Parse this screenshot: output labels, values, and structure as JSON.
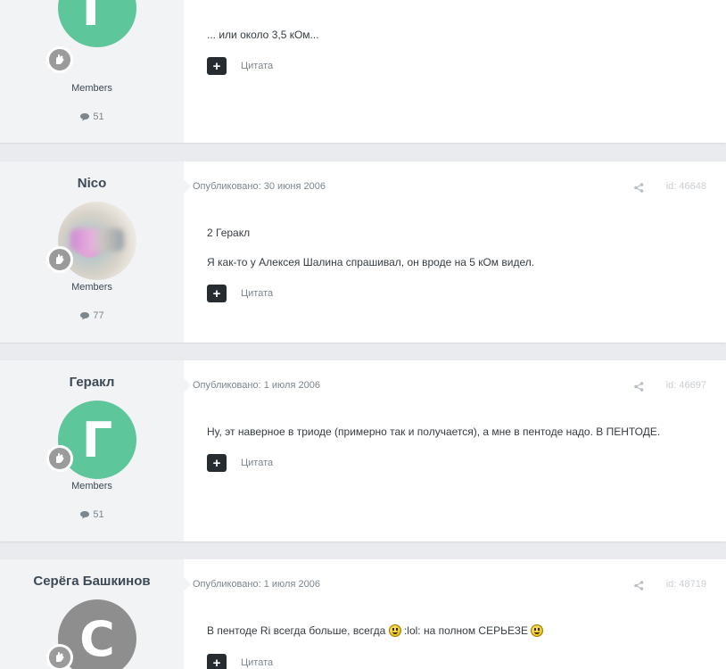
{
  "posts": [
    {
      "author": "",
      "avatar_letter": "Г",
      "avatar_color": "#5ec69b",
      "group": "Members",
      "post_count": "51",
      "date": "",
      "id": "",
      "lines": [
        "... или около 3,5 кОм..."
      ],
      "quote_label": "Цитата"
    },
    {
      "author": "Nico",
      "avatar_letter": "",
      "avatar_color": "#d9d6cf",
      "group": "Members",
      "post_count": "77",
      "date": "Опубликовано: 30 июня 2006",
      "id": "id: 46648",
      "lines": [
        "2 Геракл",
        "Я как-то у Алексея Шалина спрашивал, он вроде на 5 кОм видел."
      ],
      "quote_label": "Цитата"
    },
    {
      "author": "Геракл",
      "avatar_letter": "Г",
      "avatar_color": "#5ec69b",
      "group": "Members",
      "post_count": "51",
      "date": "Опубликовано: 1 июля 2006",
      "id": "id: 46697",
      "lines": [
        "Ну, эт наверное в триоде (примерно так и получается), а мне в пентоде надо. В ПЕНТОДЕ."
      ],
      "quote_label": "Цитата"
    },
    {
      "author": "Серёга Башкинов",
      "avatar_letter": "С",
      "avatar_color": "#8e8e8e",
      "group": "",
      "post_count": "",
      "date": "Опубликовано: 1 июля 2006",
      "id": "id: 48719",
      "line_parts": [
        "В пентоде Ri всегда больше, всегда",
        ":lol: на полном СЕРЬЕЗЕ"
      ],
      "quote_label": "Цитата"
    }
  ],
  "icons": {
    "comment": "comment-icon",
    "share": "share-icon",
    "rank": "rank-badge-icon",
    "quote": "plus-icon"
  }
}
